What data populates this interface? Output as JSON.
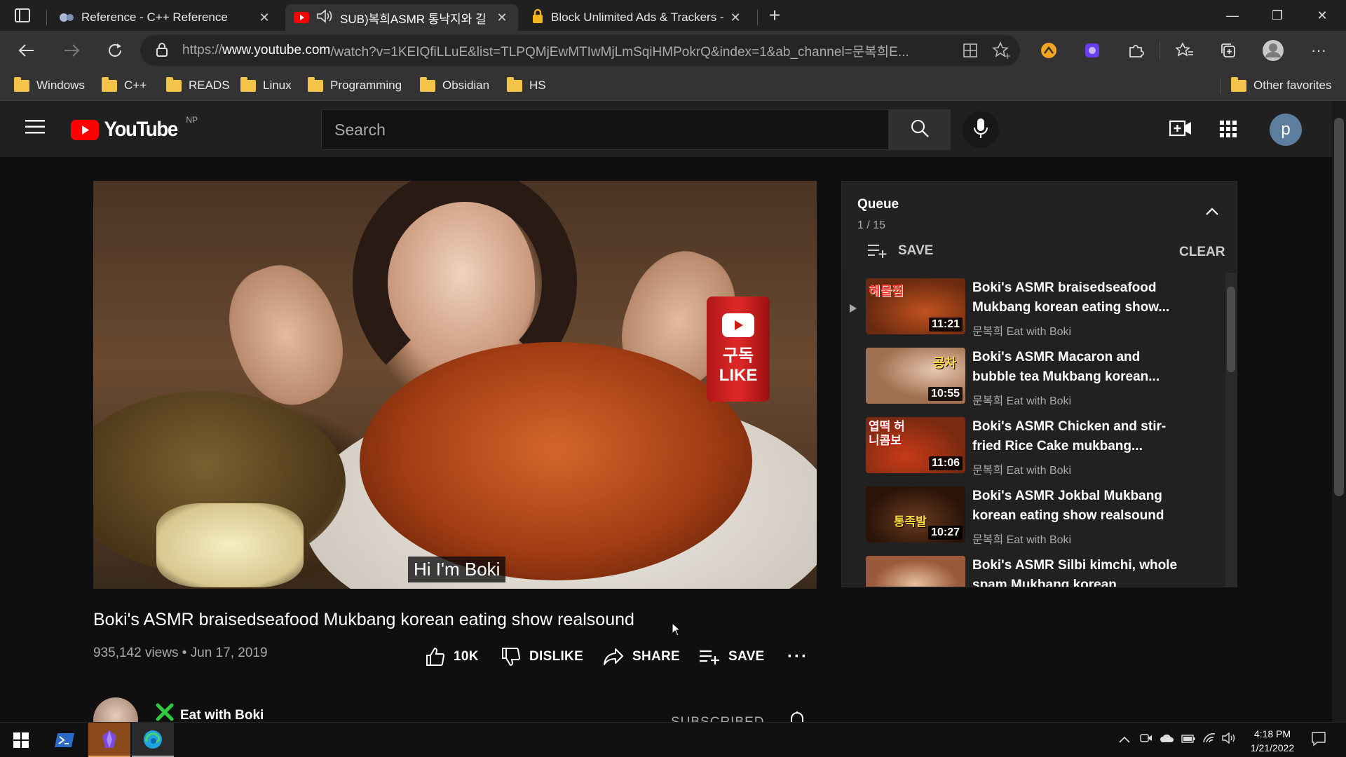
{
  "browser": {
    "tabs": [
      {
        "title": "Reference - C++ Reference",
        "active": false
      },
      {
        "title": "SUB)복희ASMR 통낙지와 길",
        "active": true,
        "audio": true
      },
      {
        "title": "Block Unlimited Ads & Trackers -",
        "active": false
      }
    ],
    "url_prefix": "https://",
    "url_host": "www.youtube.com",
    "url_rest": "/watch?v=1KEIQfiLLuE&list=TLPQMjEwMTIwMjLmSqiHMPokrQ&index=1&ab_channel=문복희E...",
    "favorites": [
      "Windows",
      "C++",
      "READS",
      "Linux",
      "Programming",
      "Obsidian",
      "HS"
    ],
    "other_favorites": "Other favorites"
  },
  "youtube": {
    "logo_text": "YouTube",
    "logo_badge": "NP",
    "search_placeholder": "Search",
    "avatar_letter": "p"
  },
  "video": {
    "caption": "Hi I'm Boki",
    "can_text_1": "구독",
    "can_text_2": "LIKE",
    "title": "Boki's ASMR braisedseafood Mukbang korean eating show realsound",
    "meta": "935,142 views • Jun 17, 2019",
    "actions": {
      "like": "10K",
      "dislike": "DISLIKE",
      "share": "SHARE",
      "save": "SAVE"
    },
    "channel": "Eat with Boki",
    "subscribed": "SUBSCRIBED"
  },
  "queue": {
    "title": "Queue",
    "position": "1 / 15",
    "save_label": "SAVE",
    "clear_label": "CLEAR",
    "items": [
      {
        "title": "Boki's ASMR braisedseafood Mukbang korean eating show...",
        "channel": "문복희 Eat with Boki",
        "duration": "11:21",
        "thumb_text": "해물찜",
        "playing": true
      },
      {
        "title": "Boki's ASMR Macaron and bubble tea Mukbang korean...",
        "channel": "문복희 Eat with Boki",
        "duration": "10:55",
        "thumb_text": "공차",
        "playing": false
      },
      {
        "title": "Boki's ASMR Chicken and stir-fried Rice Cake mukbang...",
        "channel": "문복희 Eat with Boki",
        "duration": "11:06",
        "thumb_text": "엽떡 허니콤보",
        "playing": false
      },
      {
        "title": "Boki's ASMR Jokbal Mukbang korean eating show realsound",
        "channel": "문복희 Eat with Boki",
        "duration": "10:27",
        "thumb_text": "통족발",
        "playing": false
      },
      {
        "title": "Boki's ASMR Silbi kimchi, whole spam Mukbang korean",
        "channel": "",
        "duration": "",
        "thumb_text": "",
        "playing": false
      }
    ]
  },
  "taskbar": {
    "time": "4:18 PM",
    "date": "1/21/2022"
  },
  "colors": {
    "youtube_red": "#ff0000",
    "folder_yellow": "#f3c34a",
    "channel_check": "#2ecc40"
  }
}
